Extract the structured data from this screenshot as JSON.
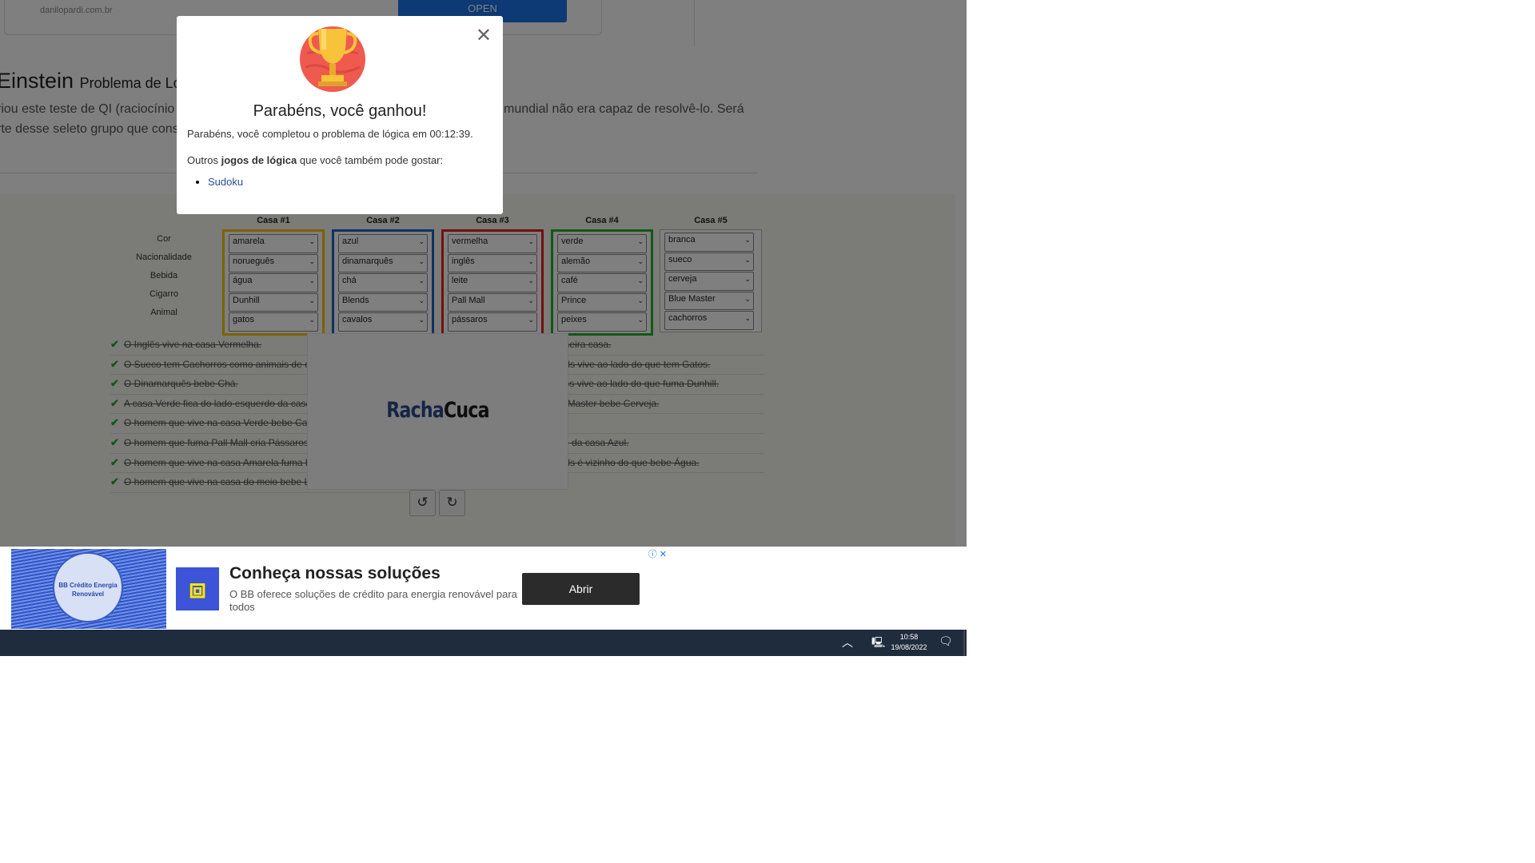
{
  "top_ad": {
    "url": "danilopardi.com.br",
    "open_label": "OPEN"
  },
  "heading": {
    "title": "Einstein",
    "subtitle": "Problema de Lógica"
  },
  "intro": {
    "line1_left": "riou este teste de QI (raciocínio l",
    "line1_right": "mundial não era capaz de resolvê-lo. Será",
    "line2": "rte desse seleto grupo que conse"
  },
  "row_labels": [
    "Cor",
    "Nacionalidade",
    "Bebida",
    "Cigarro",
    "Animal"
  ],
  "houses": [
    {
      "label": "Casa #1",
      "color": "#f5c400",
      "values": [
        "amarela",
        "norueguês",
        "água",
        "Dunhill",
        "gatos"
      ]
    },
    {
      "label": "Casa #2",
      "color": "#1f64c8",
      "values": [
        "azul",
        "dinamarquês",
        "chá",
        "Blends",
        "cavalos"
      ]
    },
    {
      "label": "Casa #3",
      "color": "#e02020",
      "values": [
        "vermelha",
        "inglês",
        "leite",
        "Pall Mall",
        "pássaros"
      ]
    },
    {
      "label": "Casa #4",
      "color": "#22b12e",
      "values": [
        "verde",
        "alemão",
        "café",
        "Prince",
        "peixes"
      ]
    },
    {
      "label": "Casa #5",
      "color": "#bbbbbb",
      "values": [
        "branca",
        "sueco",
        "cerveja",
        "Blue Master",
        "cachorros"
      ]
    }
  ],
  "clues_left": [
    "O Inglês vive na casa Vermelha.",
    "O Sueco tem Cachorros como animais de estimação.",
    "O Dinamarquês bebe Chá.",
    "A casa Verde fica do lado esquerdo da casa Branca.",
    "O homem que vive na casa Verde bebe Café.",
    "O homem que fuma Pall Mall cria Pássaros.",
    "O homem que vive na casa Amarela fuma Dunhill.",
    "O homem que vive na casa do meio bebe Leite."
  ],
  "clues_right": [
    "O Norueguês vive na primeira casa.",
    "O homem que fuma Blends vive ao lado do que tem Gatos.",
    "O homem que cria Cavalos vive ao lado do que fuma Dunhill.",
    "O homem que fuma Blue Master bebe Cerveja.",
    "O Alemão fuma Prince.",
    "O Norueguês vive ao lado da casa Azul.",
    "O homem que fuma Blends é vizinho do que bebe Água."
  ],
  "logo": {
    "part1": "Racha",
    "part2": "Cuca"
  },
  "modal": {
    "title": "Parabéns, você ganhou!",
    "message": "Parabéns, você completou o problema de lógica em 00:12:39.",
    "other_prefix": "Outros ",
    "other_bold": "jogos de lógica",
    "other_suffix": " que você também pode gostar:",
    "links": [
      "Sudoku"
    ]
  },
  "ad": {
    "badge_text": "BB Crédito Energia Renovável",
    "title": "Conheça nossas soluções",
    "description": "O BB oferece soluções de crédito para energia renovável para todos",
    "button": "Abrir"
  },
  "taskbar": {
    "time": "10:58",
    "date": "19/08/2022"
  },
  "colors": {
    "modal_title": "#222222",
    "overlay": "rgba(0,0,0,0.5)"
  }
}
